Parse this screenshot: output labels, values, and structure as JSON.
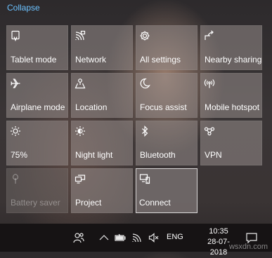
{
  "header": {
    "collapse_label": "Collapse"
  },
  "tiles": [
    {
      "label": "Tablet mode",
      "icon": "tablet-mode-icon"
    },
    {
      "label": "Network",
      "icon": "network-icon"
    },
    {
      "label": "All settings",
      "icon": "gear-icon"
    },
    {
      "label": "Nearby sharing",
      "icon": "share-icon"
    },
    {
      "label": "Airplane mode",
      "icon": "airplane-icon"
    },
    {
      "label": "Location",
      "icon": "location-icon"
    },
    {
      "label": "Focus assist",
      "icon": "moon-icon"
    },
    {
      "label": "Mobile hotspot",
      "icon": "hotspot-icon"
    },
    {
      "label": "75%",
      "icon": "brightness-icon"
    },
    {
      "label": "Night light",
      "icon": "night-light-icon"
    },
    {
      "label": "Bluetooth",
      "icon": "bluetooth-icon"
    },
    {
      "label": "VPN",
      "icon": "vpn-icon"
    },
    {
      "label": "Battery saver",
      "icon": "battery-saver-icon",
      "state": "disabled"
    },
    {
      "label": "Project",
      "icon": "project-icon"
    },
    {
      "label": "Connect",
      "icon": "connect-icon",
      "state": "selected"
    }
  ],
  "taskbar": {
    "language": "ENG",
    "time": "10:35",
    "date": "28-07-2018"
  },
  "watermark": "wsxdn.com",
  "colors": {
    "accent": "#6cc2ff",
    "taskbar": "#161314"
  }
}
